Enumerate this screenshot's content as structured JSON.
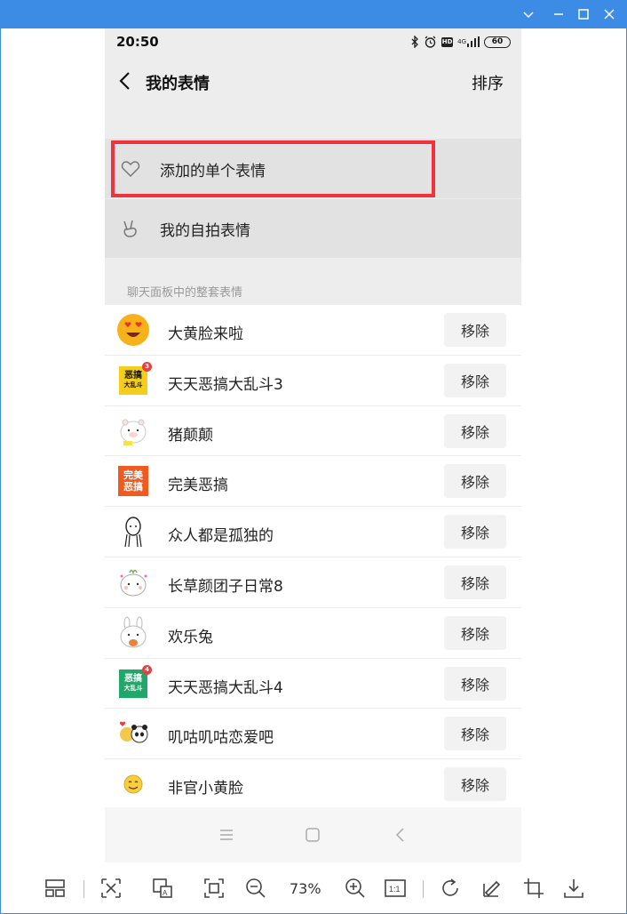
{
  "window": {
    "buttons": [
      "minimize",
      "maximize",
      "close",
      "dropdown"
    ]
  },
  "phone": {
    "status": {
      "time": "20:50",
      "battery": "60",
      "hd": "HD",
      "network": "4G"
    },
    "nav": {
      "title": "我的表情",
      "sort_label": "排序"
    },
    "top_items": [
      {
        "label": "添加的单个表情",
        "icon": "heart-icon",
        "highlighted": true
      },
      {
        "label": "我的自拍表情",
        "icon": "victory-hand-icon",
        "highlighted": false
      }
    ],
    "section_label": "聊天面板中的整套表情",
    "sticker_packs": [
      {
        "name": "大黄脸来啦",
        "remove": "移除",
        "icon": "heart-eyes-face-icon"
      },
      {
        "name": "天天恶搞大乱斗3",
        "remove": "移除",
        "icon": "egao-yellow-icon",
        "thumb_text": "恶搞",
        "thumb_sub": "大乱斗",
        "badge": "3"
      },
      {
        "name": "猪颠颠",
        "remove": "移除",
        "icon": "pig-icon"
      },
      {
        "name": "完美恶搞",
        "remove": "移除",
        "icon": "wanmei-egao-icon",
        "thumb_text": "完美",
        "thumb_sub": "恶搞"
      },
      {
        "name": "众人都是孤独的",
        "remove": "移除",
        "icon": "lonely-figure-icon"
      },
      {
        "name": "长草颜团子日常8",
        "remove": "移除",
        "icon": "tuanzi-icon"
      },
      {
        "name": "欢乐兔",
        "remove": "移除",
        "icon": "rabbit-icon"
      },
      {
        "name": "天天恶搞大乱斗4",
        "remove": "移除",
        "icon": "egao-green-icon",
        "thumb_text": "恶搞",
        "thumb_sub": "大乱斗",
        "badge": "4"
      },
      {
        "name": "叽咕叽咕恋爱吧",
        "remove": "移除",
        "icon": "panda-couple-icon"
      },
      {
        "name": "非官小黄脸",
        "remove": "移除",
        "icon": "smile-face-icon"
      }
    ]
  },
  "viewer": {
    "zoom": "73%",
    "tools": [
      "thumbnails-icon",
      "fit-icon",
      "ocr-icon",
      "fullscreen-icon",
      "zoom-out-icon",
      "zoom-in-icon",
      "actual-size-icon",
      "rotate-icon",
      "edit-icon",
      "crop-icon",
      "download-icon"
    ],
    "actual_size_label": "1:1"
  },
  "colors": {
    "titlebar": "#3c8ce6",
    "highlight": "#f0323c",
    "background": "#ededed"
  }
}
